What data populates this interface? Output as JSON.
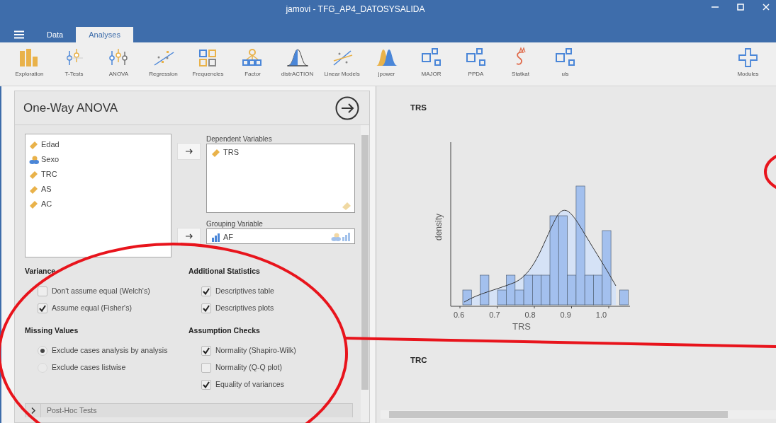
{
  "window": {
    "title": "jamovi - TFG_AP4_DATOSYSALIDA"
  },
  "menu_tabs": [
    {
      "label": "Data",
      "selected": false
    },
    {
      "label": "Analyses",
      "selected": true
    }
  ],
  "toolbar": [
    {
      "label": "Exploration",
      "kind": "bars"
    },
    {
      "label": "T-Tests",
      "kind": "ttest"
    },
    {
      "label": "ANOVA",
      "kind": "anova"
    },
    {
      "label": "Regression",
      "kind": "regression"
    },
    {
      "label": "Frequencies",
      "kind": "squares"
    },
    {
      "label": "Factor",
      "kind": "factor"
    },
    {
      "label": "distrACTION",
      "kind": "distribution"
    },
    {
      "label": "Linear Models",
      "kind": "linear"
    },
    {
      "label": "jpower",
      "kind": "power"
    },
    {
      "label": "MAJOR",
      "kind": "module"
    },
    {
      "label": "PPDA",
      "kind": "module"
    },
    {
      "label": "Statkat",
      "kind": "statkat"
    },
    {
      "label": "uls",
      "kind": "module"
    }
  ],
  "modules_button": {
    "label": "Modules"
  },
  "analysis": {
    "title": "One-Way ANOVA",
    "variables": [
      {
        "name": "Edad",
        "kind": "continuous"
      },
      {
        "name": "Sexo",
        "kind": "nominal"
      },
      {
        "name": "TRC",
        "kind": "continuous"
      },
      {
        "name": "AS",
        "kind": "continuous"
      },
      {
        "name": "AC",
        "kind": "continuous"
      }
    ],
    "dependent": {
      "label": "Dependent Variables",
      "items": [
        {
          "name": "TRS",
          "kind": "continuous"
        }
      ]
    },
    "grouping": {
      "label": "Grouping Variable",
      "items": [
        {
          "name": "AF",
          "kind": "ordinal"
        }
      ]
    },
    "option_columns": [
      [
        {
          "heading": "Variance",
          "options": [
            {
              "kind": "checkbox",
              "label": "Don't assume equal (Welch's)",
              "checked": false
            },
            {
              "kind": "checkbox",
              "label": "Assume equal (Fisher's)",
              "checked": true
            }
          ]
        },
        {
          "heading": "Missing Values",
          "options": [
            {
              "kind": "radio",
              "label": "Exclude cases analysis by analysis",
              "checked": true
            },
            {
              "kind": "radio",
              "label": "Exclude cases listwise",
              "checked": false
            }
          ]
        }
      ],
      [
        {
          "heading": "Additional Statistics",
          "options": [
            {
              "kind": "checkbox",
              "label": "Descriptives table",
              "checked": true
            },
            {
              "kind": "checkbox",
              "label": "Descriptives plots",
              "checked": true
            }
          ]
        },
        {
          "heading": "Assumption Checks",
          "options": [
            {
              "kind": "checkbox",
              "label": "Normality (Shapiro-Wilk)",
              "checked": true
            },
            {
              "kind": "checkbox",
              "label": "Normality (Q-Q plot)",
              "checked": false
            },
            {
              "kind": "checkbox",
              "label": "Equality of variances",
              "checked": true
            }
          ]
        }
      ]
    ],
    "collapsed_section": {
      "label": "Post-Hoc Tests",
      "expanded": false
    }
  },
  "results": {
    "plots": [
      {
        "title": "TRS",
        "xlabel": "TRS",
        "ylabel": "density",
        "xticks": [
          "0.6",
          "0.7",
          "0.8",
          "0.9",
          "1.0"
        ]
      },
      {
        "title": "TRC"
      }
    ]
  }
}
